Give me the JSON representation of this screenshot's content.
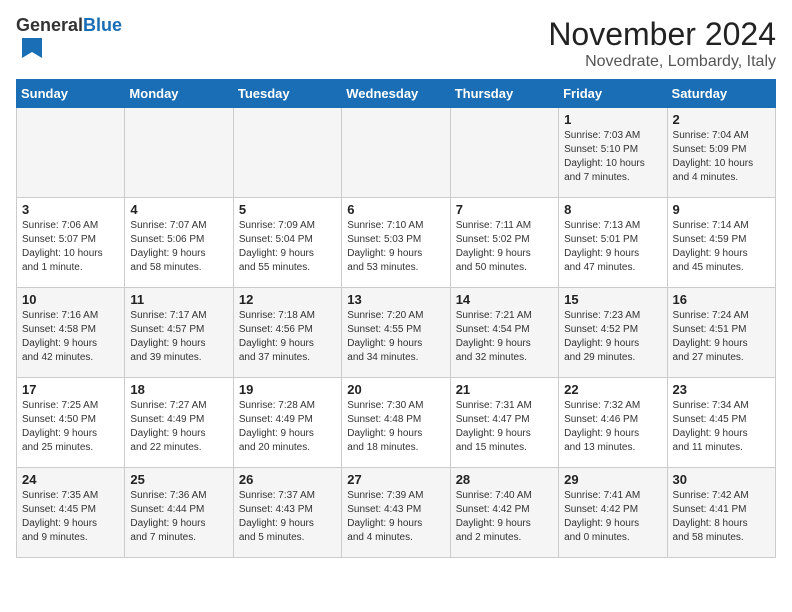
{
  "header": {
    "logo_general": "General",
    "logo_blue": "Blue",
    "title": "November 2024",
    "subtitle": "Novedrate, Lombardy, Italy"
  },
  "weekdays": [
    "Sunday",
    "Monday",
    "Tuesday",
    "Wednesday",
    "Thursday",
    "Friday",
    "Saturday"
  ],
  "weeks": [
    [
      {
        "day": "",
        "info": ""
      },
      {
        "day": "",
        "info": ""
      },
      {
        "day": "",
        "info": ""
      },
      {
        "day": "",
        "info": ""
      },
      {
        "day": "",
        "info": ""
      },
      {
        "day": "1",
        "info": "Sunrise: 7:03 AM\nSunset: 5:10 PM\nDaylight: 10 hours\nand 7 minutes."
      },
      {
        "day": "2",
        "info": "Sunrise: 7:04 AM\nSunset: 5:09 PM\nDaylight: 10 hours\nand 4 minutes."
      }
    ],
    [
      {
        "day": "3",
        "info": "Sunrise: 7:06 AM\nSunset: 5:07 PM\nDaylight: 10 hours\nand 1 minute."
      },
      {
        "day": "4",
        "info": "Sunrise: 7:07 AM\nSunset: 5:06 PM\nDaylight: 9 hours\nand 58 minutes."
      },
      {
        "day": "5",
        "info": "Sunrise: 7:09 AM\nSunset: 5:04 PM\nDaylight: 9 hours\nand 55 minutes."
      },
      {
        "day": "6",
        "info": "Sunrise: 7:10 AM\nSunset: 5:03 PM\nDaylight: 9 hours\nand 53 minutes."
      },
      {
        "day": "7",
        "info": "Sunrise: 7:11 AM\nSunset: 5:02 PM\nDaylight: 9 hours\nand 50 minutes."
      },
      {
        "day": "8",
        "info": "Sunrise: 7:13 AM\nSunset: 5:01 PM\nDaylight: 9 hours\nand 47 minutes."
      },
      {
        "day": "9",
        "info": "Sunrise: 7:14 AM\nSunset: 4:59 PM\nDaylight: 9 hours\nand 45 minutes."
      }
    ],
    [
      {
        "day": "10",
        "info": "Sunrise: 7:16 AM\nSunset: 4:58 PM\nDaylight: 9 hours\nand 42 minutes."
      },
      {
        "day": "11",
        "info": "Sunrise: 7:17 AM\nSunset: 4:57 PM\nDaylight: 9 hours\nand 39 minutes."
      },
      {
        "day": "12",
        "info": "Sunrise: 7:18 AM\nSunset: 4:56 PM\nDaylight: 9 hours\nand 37 minutes."
      },
      {
        "day": "13",
        "info": "Sunrise: 7:20 AM\nSunset: 4:55 PM\nDaylight: 9 hours\nand 34 minutes."
      },
      {
        "day": "14",
        "info": "Sunrise: 7:21 AM\nSunset: 4:54 PM\nDaylight: 9 hours\nand 32 minutes."
      },
      {
        "day": "15",
        "info": "Sunrise: 7:23 AM\nSunset: 4:52 PM\nDaylight: 9 hours\nand 29 minutes."
      },
      {
        "day": "16",
        "info": "Sunrise: 7:24 AM\nSunset: 4:51 PM\nDaylight: 9 hours\nand 27 minutes."
      }
    ],
    [
      {
        "day": "17",
        "info": "Sunrise: 7:25 AM\nSunset: 4:50 PM\nDaylight: 9 hours\nand 25 minutes."
      },
      {
        "day": "18",
        "info": "Sunrise: 7:27 AM\nSunset: 4:49 PM\nDaylight: 9 hours\nand 22 minutes."
      },
      {
        "day": "19",
        "info": "Sunrise: 7:28 AM\nSunset: 4:49 PM\nDaylight: 9 hours\nand 20 minutes."
      },
      {
        "day": "20",
        "info": "Sunrise: 7:30 AM\nSunset: 4:48 PM\nDaylight: 9 hours\nand 18 minutes."
      },
      {
        "day": "21",
        "info": "Sunrise: 7:31 AM\nSunset: 4:47 PM\nDaylight: 9 hours\nand 15 minutes."
      },
      {
        "day": "22",
        "info": "Sunrise: 7:32 AM\nSunset: 4:46 PM\nDaylight: 9 hours\nand 13 minutes."
      },
      {
        "day": "23",
        "info": "Sunrise: 7:34 AM\nSunset: 4:45 PM\nDaylight: 9 hours\nand 11 minutes."
      }
    ],
    [
      {
        "day": "24",
        "info": "Sunrise: 7:35 AM\nSunset: 4:45 PM\nDaylight: 9 hours\nand 9 minutes."
      },
      {
        "day": "25",
        "info": "Sunrise: 7:36 AM\nSunset: 4:44 PM\nDaylight: 9 hours\nand 7 minutes."
      },
      {
        "day": "26",
        "info": "Sunrise: 7:37 AM\nSunset: 4:43 PM\nDaylight: 9 hours\nand 5 minutes."
      },
      {
        "day": "27",
        "info": "Sunrise: 7:39 AM\nSunset: 4:43 PM\nDaylight: 9 hours\nand 4 minutes."
      },
      {
        "day": "28",
        "info": "Sunrise: 7:40 AM\nSunset: 4:42 PM\nDaylight: 9 hours\nand 2 minutes."
      },
      {
        "day": "29",
        "info": "Sunrise: 7:41 AM\nSunset: 4:42 PM\nDaylight: 9 hours\nand 0 minutes."
      },
      {
        "day": "30",
        "info": "Sunrise: 7:42 AM\nSunset: 4:41 PM\nDaylight: 8 hours\nand 58 minutes."
      }
    ]
  ]
}
